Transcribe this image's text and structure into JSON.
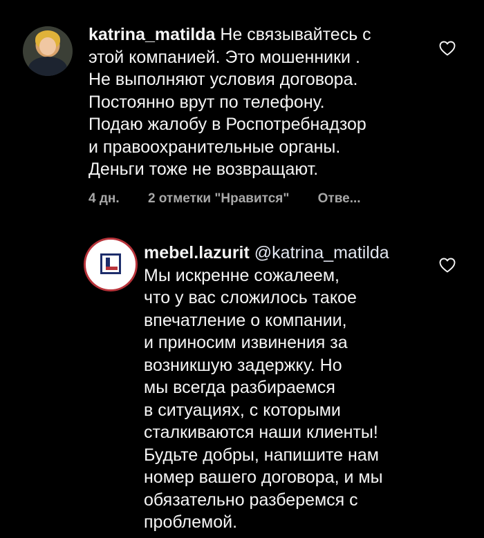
{
  "comments": [
    {
      "username": "katrina_matilda",
      "lines": [
        "Не связывайтесь с",
        "этой компанией. Это мошенники .",
        "Не выполняют условия договора.",
        "Постоянно врут по телефону.",
        "Подаю жалобу в Роспотребнадзор",
        "и правоохранительные органы.",
        "Деньги тоже не возвращают."
      ],
      "time": "4 дн.",
      "likes": "2 отметки \"Нравится\"",
      "reply": "Отве..."
    },
    {
      "username": "mebel.lazurit",
      "mention": "@katrina_matilda",
      "lines": [
        "Мы искренне сожалеем,",
        "что у вас сложилось такое",
        "впечатление о компании,",
        "и приносим извинения за",
        "возникшую задержку. Но",
        "мы всегда разбираемся",
        "в ситуациях, с которыми",
        "сталкиваются наши клиенты!",
        "Будьте добры, напишите нам",
        "номер вашего договора, и мы",
        "обязательно разберемся с",
        "проблемой."
      ]
    }
  ],
  "icons": {
    "like": "heart-outline-icon",
    "logo": "lazurit-logo"
  },
  "colors": {
    "background": "#000000",
    "text": "#f5f5f5",
    "meta": "#a8a8a8",
    "logo_blue": "#1d2d6b",
    "logo_red": "#b8343b"
  }
}
